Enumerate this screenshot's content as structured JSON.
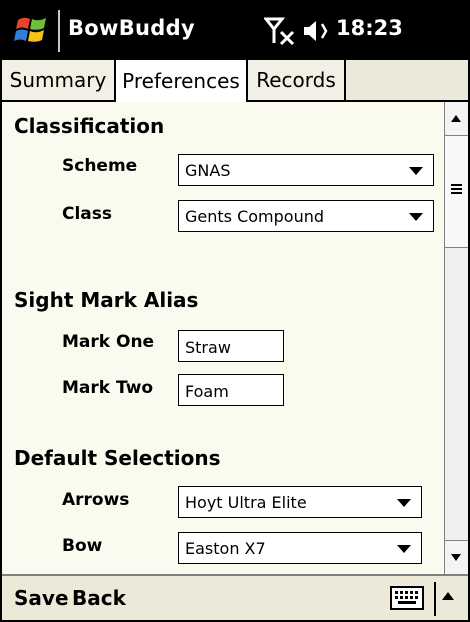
{
  "title_bar": {
    "app_title": "BowBuddy",
    "clock": "18:23"
  },
  "tabs": [
    {
      "label": "Summary",
      "selected": false
    },
    {
      "label": "Preferences",
      "selected": true
    },
    {
      "label": "Records",
      "selected": false
    }
  ],
  "classification": {
    "title": "Classification",
    "scheme_label": "Scheme",
    "scheme_value": "GNAS",
    "class_label": "Class",
    "class_value": "Gents Compound"
  },
  "sight_mark_alias": {
    "title": "Sight Mark Alias",
    "mark_one_label": "Mark One",
    "mark_one_value": "Straw",
    "mark_two_label": "Mark Two",
    "mark_two_value": "Foam"
  },
  "default_selections": {
    "title": "Default Selections",
    "arrows_label": "Arrows",
    "arrows_value": "Hoyt Ultra Elite",
    "bow_label": "Bow",
    "bow_value": "Easton X7"
  },
  "softkeys": {
    "left": "Save",
    "right": "Back"
  },
  "colors": {
    "title_bar": "#000000",
    "content_bg": "#fafaee",
    "tab_bar": "#ece9d8"
  },
  "icons": [
    "windows-flag-icon",
    "signal-off-icon",
    "volume-icon",
    "keyboard-icon"
  ]
}
